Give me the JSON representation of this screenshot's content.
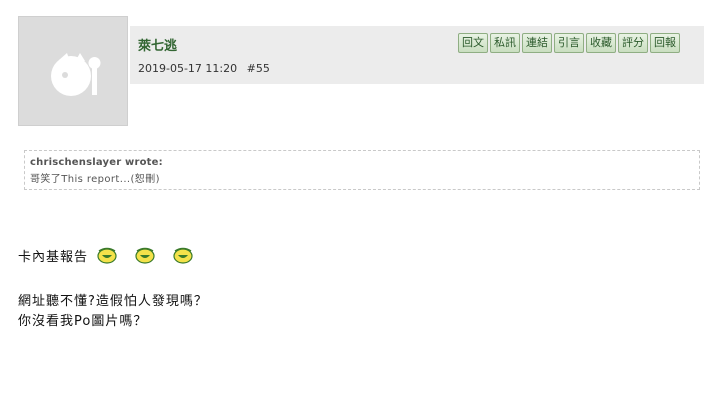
{
  "post": {
    "username": "萊七逃",
    "datetime": "2019-05-17 11:20",
    "post_number": "#55"
  },
  "actions": [
    {
      "label": "回文"
    },
    {
      "label": "私訊"
    },
    {
      "label": "連結"
    },
    {
      "label": "引言"
    },
    {
      "label": "收藏"
    },
    {
      "label": "評分"
    },
    {
      "label": "回報"
    }
  ],
  "quote": {
    "author": "chrischenslayer wrote:",
    "text": "哥笑了This report...(恕刪)"
  },
  "content": {
    "line1": "卡內基報告",
    "emoticons": [
      "laugh-emoticon",
      "laugh-emoticon",
      "laugh-emoticon"
    ],
    "line2": "網址聽不懂?造假怕人發現嗎？",
    "line3": "你沒看我Po圖片嗎？"
  },
  "colors": {
    "username": "#336633",
    "button_bg": "#d6e8cf",
    "button_border": "#8fae83",
    "header_bg": "#ececec",
    "avatar_bg": "#dcdcdc"
  }
}
